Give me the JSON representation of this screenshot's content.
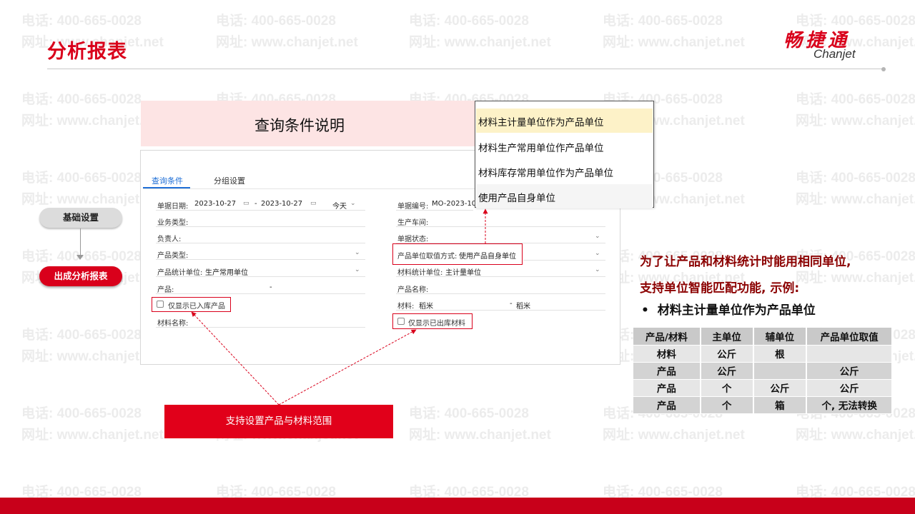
{
  "watermark": {
    "phone": "电话: 400-665-0028",
    "site": "网址: www.chanjet.net"
  },
  "header": {
    "title": "分析报表",
    "logo_cn": "畅捷通",
    "logo_en": "Chanjet"
  },
  "section_title": "查询条件说明",
  "form": {
    "tabs": [
      {
        "label": "查询条件",
        "active": true
      },
      {
        "label": "分组设置",
        "active": false
      }
    ],
    "left": {
      "date_label": "单据日期:",
      "date_from": "2023-10-27",
      "date_sep": "-",
      "date_to": "2023-10-27",
      "date_preset": "今天",
      "biz_type_label": "业务类型:",
      "owner_label": "负责人:",
      "product_type_label": "产品类型:",
      "product_unit_label": "产品统计单位:",
      "product_unit_value": "生产常用单位",
      "product_label": "产品:",
      "product_sep": "-",
      "only_stocked_product": "仅显示已入库产品",
      "material_name_label": "材料名称:"
    },
    "right": {
      "doc_no_label": "单据编号:",
      "doc_no_value": "MO-2023-10-",
      "workshop_label": "生产车间:",
      "status_label": "单据状态:",
      "product_unit_mode_label": "产品单位取值方式:",
      "product_unit_mode_value": "使用产品自身单位",
      "material_unit_label": "材料统计单位:",
      "material_unit_value": "主计量单位",
      "product_name_label": "产品名称:",
      "material_label": "材料:",
      "material_from": "稻米",
      "material_sep": "-",
      "material_to": "稻米",
      "only_issued_material": "仅显示已出库材料"
    }
  },
  "dropdown": {
    "options": [
      {
        "label": "材料主计量单位作为产品单位",
        "selected": true
      },
      {
        "label": "材料生产常用单位作产品单位",
        "selected": false
      },
      {
        "label": "材料库存常用单位作为产品单位",
        "selected": false
      },
      {
        "label": "使用产品自身单位",
        "selected": false
      }
    ]
  },
  "flow": {
    "step1": "基础设置",
    "step2": "出成分析报表"
  },
  "callout": "支持设置产品与材料范围",
  "right_text": {
    "line1": "为了让产品和材料统计时能用相同单位,",
    "line2": "支持单位智能匹配功能, 示例:",
    "bullet": "材料主计量单位作为产品单位"
  },
  "unit_table": {
    "headers": [
      "产品/材料",
      "主单位",
      "辅单位",
      "产品单位取值"
    ],
    "rows": [
      [
        "材料",
        "公斤",
        "根",
        ""
      ],
      [
        "产品",
        "公斤",
        "",
        "公斤"
      ],
      [
        "产品",
        "个",
        "公斤",
        "公斤"
      ],
      [
        "产品",
        "个",
        "箱",
        "个, 无法转换"
      ]
    ]
  },
  "colors": {
    "brand_red": "#d9001b",
    "link_blue": "#1f6fd6",
    "dark_red_text": "#8b0000"
  }
}
